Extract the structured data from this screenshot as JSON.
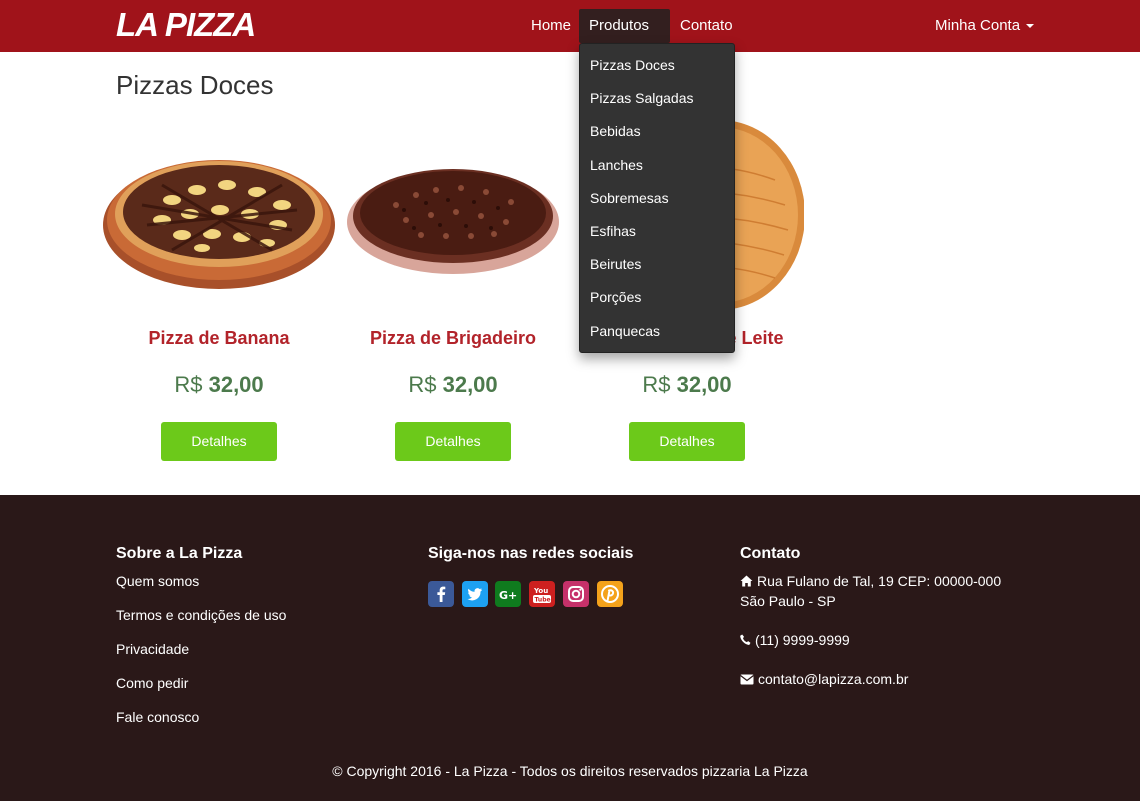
{
  "navbar": {
    "brand": "LA PIZZA",
    "links": {
      "home": "Home",
      "produtos": "Produtos",
      "contato": "Contato",
      "conta": "Minha Conta"
    }
  },
  "dropdown": {
    "items": [
      "Pizzas Doces",
      "Pizzas Salgadas",
      "Bebidas",
      "Lanches",
      "Sobremesas",
      "Esfihas",
      "Beirutes",
      "Porções",
      "Panquecas"
    ]
  },
  "main": {
    "title": "Pizzas Doces",
    "products": [
      {
        "name": "Pizza de Banana",
        "currency": "R$",
        "price": "32,00",
        "button": "Detalhes"
      },
      {
        "name": "Pizza de Brigadeiro",
        "currency": "R$",
        "price": "32,00",
        "button": "Detalhes"
      },
      {
        "name": "Pizza de Doce de Leite",
        "currency": "R$",
        "price": "32,00",
        "button": "Detalhes"
      }
    ]
  },
  "footer": {
    "about": {
      "title": "Sobre a La Pizza",
      "links": [
        "Quem somos",
        "Termos e condições de uso",
        "Privacidade",
        "Como pedir",
        "Fale conosco"
      ]
    },
    "social": {
      "title": "Siga-nos nas redes sociais",
      "icons": [
        "facebook-icon",
        "twitter-icon",
        "google-plus-icon",
        "youtube-icon",
        "instagram-icon",
        "pinterest-icon"
      ]
    },
    "contact": {
      "title": "Contato",
      "address_line1": "Rua Fulano de Tal, 19 CEP: 00000-000",
      "address_line2": "São Paulo - SP",
      "phone": "(11) 9999-9999",
      "email": "contato@lapizza.com.br"
    },
    "copyright": "© Copyright 2016 - La Pizza - Todos os direitos reservados pizzaria La Pizza"
  },
  "colors": {
    "navbar": "#a0131a",
    "accent_button": "#6cc91a",
    "product_name": "#b2232a",
    "price": "#4c7a4c",
    "footer": "#2a1818"
  }
}
